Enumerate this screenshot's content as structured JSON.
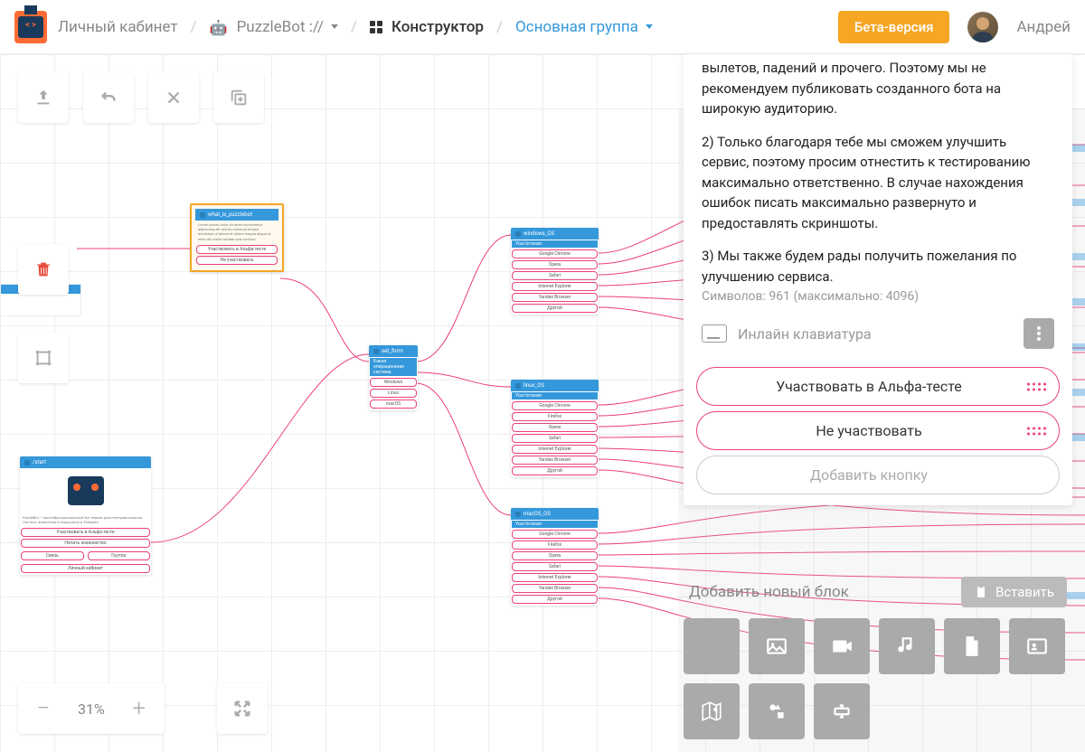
{
  "breadcrumb": {
    "home": "Личный кабинет",
    "bot": "PuzzleBot :// ",
    "constructor": "Конструктор",
    "group": "Основная группа"
  },
  "header": {
    "beta": "Бета-версия",
    "user": "Андрей"
  },
  "zoom": "31%",
  "nodes": {
    "what_is": {
      "title": "what_is_puzzlebot"
    },
    "set_form": {
      "title": "set_form",
      "rows": [
        "Windows",
        "Linux",
        "macOS"
      ]
    },
    "start": {
      "title": "/start",
      "rows": [
        {
          "a": "Начать знакомство",
          "b": ""
        },
        {
          "a": "Связь",
          "b": "Группа"
        },
        {
          "a": "Личный кабинет",
          "b": ""
        }
      ]
    },
    "windows": {
      "title": "windows_OS",
      "rows": [
        "Google Chrome",
        "Opera",
        "Safari",
        "Internet Explorer",
        "Yandex Browser",
        "Другой"
      ]
    },
    "linux": {
      "title": "linux_OS",
      "rows": [
        "Google Chrome",
        "Firefox",
        "Opera",
        "Safari",
        "Internet Explorer",
        "Yandex Browser",
        "Другой"
      ]
    },
    "macos": {
      "title": "macOS_OS",
      "rows": [
        "Google Chrome",
        "Firefox",
        "Opera",
        "Safari",
        "Internet Explorer",
        "Yandex Browser",
        "Другой"
      ]
    }
  },
  "panel": {
    "p1": "вылетов, падений и прочего. Поэтому мы не рекомендуем публиковать созданного бота на широкую аудиторию.",
    "p2": "2) Только благодаря тебе мы сможем улучшить сервис, поэтому просим отнестить к тестированию максимально ответственно. В случае нахождения ошибок писать максимально развернуто и предоставлять скриншоты.",
    "p3": "3) Мы также будем рады получить пожелания по улучшению сервиса.",
    "chars": "Символов: 961 (максимально: 4096)",
    "keyboard": "Инлайн клавиатура",
    "btn1": "Участвовать в Альфа-тесте",
    "btn2": "Не участвовать",
    "btn3": "Добавить кнопку"
  },
  "addblock": {
    "title": "Добавить новый блок",
    "paste": "Вставить"
  }
}
